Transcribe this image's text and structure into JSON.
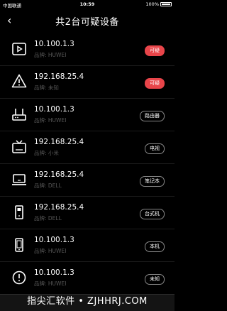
{
  "status": {
    "carrier": "中国联通",
    "time": "10:59",
    "battery": "100%"
  },
  "header": {
    "title": "共2台可疑设备"
  },
  "devices": [
    {
      "ip": "10.100.1.3",
      "brand": "品牌: HUWEI",
      "tag": "可疑",
      "icon": "tv-play-icon",
      "tag_style": "red"
    },
    {
      "ip": "192.168.25.4",
      "brand": "品牌: 未知",
      "tag": "可疑",
      "icon": "warning-icon",
      "tag_style": "red"
    },
    {
      "ip": "10.100.1.3",
      "brand": "品牌: HUWEI",
      "tag": "路由器",
      "icon": "router-icon",
      "tag_style": "gray"
    },
    {
      "ip": "192.168.25.4",
      "brand": "品牌: 小米",
      "tag": "电视",
      "icon": "tv-icon",
      "tag_style": "gray"
    },
    {
      "ip": "192.168.25.4",
      "brand": "品牌: DELL",
      "tag": "笔记本",
      "icon": "laptop-icon",
      "tag_style": "gray"
    },
    {
      "ip": "192.168.25.4",
      "brand": "品牌: DELL",
      "tag": "台式机",
      "icon": "desktop-icon",
      "tag_style": "gray"
    },
    {
      "ip": "10.100.1.3",
      "brand": "品牌: HUWEI",
      "tag": "本机",
      "icon": "phone-icon",
      "tag_style": "gray"
    },
    {
      "ip": "10.100.1.3",
      "brand": "品牌: HUWEI",
      "tag": "未知",
      "icon": "unknown-icon",
      "tag_style": "gray"
    }
  ],
  "watermark": "指尖汇软件 • ZJHHRJ.COM"
}
